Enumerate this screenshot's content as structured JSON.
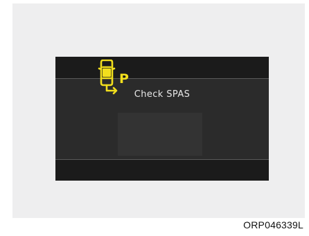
{
  "display": {
    "message": "Check SPAS",
    "icon": "parking-assist-car-icon",
    "icon_letter": "P",
    "icon_color": "#f2df1d"
  },
  "caption": "ORP046339L"
}
